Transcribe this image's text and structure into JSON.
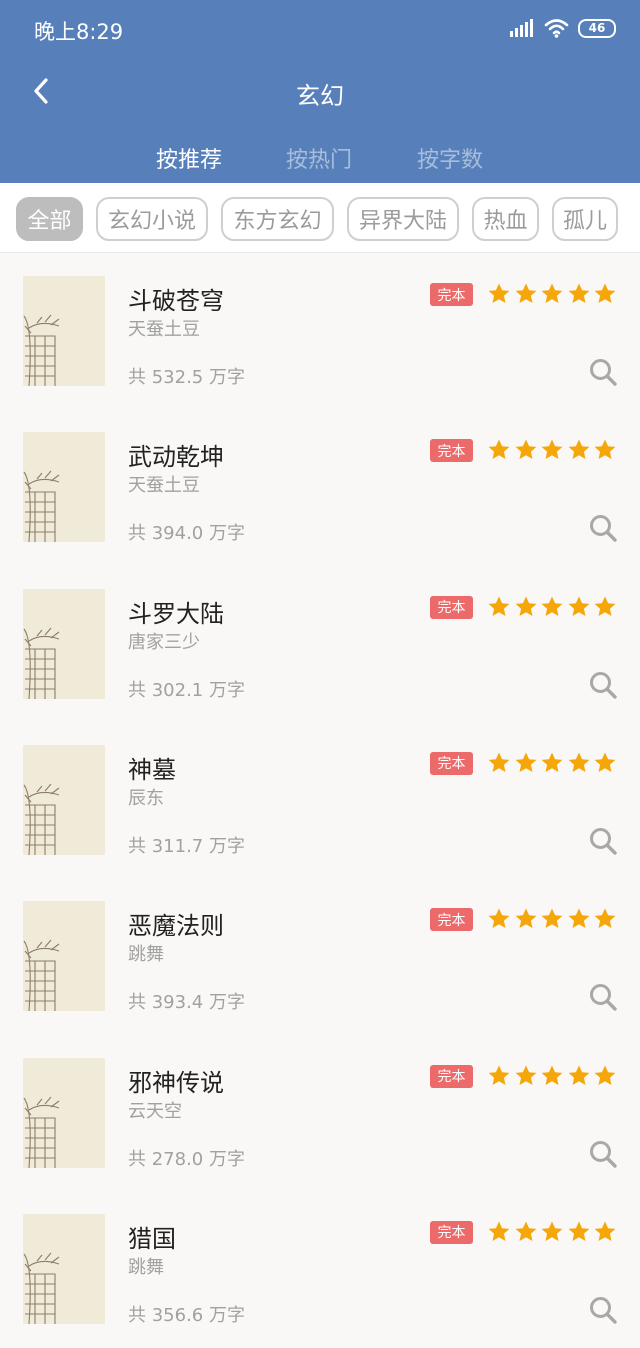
{
  "status_bar": {
    "time": "晚上8:29",
    "battery": "46"
  },
  "header": {
    "title": "玄幻"
  },
  "tabs": [
    {
      "label": "按推荐"
    },
    {
      "label": "按热门"
    },
    {
      "label": "按字数"
    }
  ],
  "filters": [
    "全部",
    "玄幻小说",
    "东方玄幻",
    "异界大陆",
    "热血",
    "孤儿"
  ],
  "books": [
    {
      "title": "斗破苍穹",
      "author": "天蚕土豆",
      "count": "共 532.5 万字",
      "status": "完本",
      "rating": 5
    },
    {
      "title": "武动乾坤",
      "author": "天蚕土豆",
      "count": "共 394.0 万字",
      "status": "完本",
      "rating": 5
    },
    {
      "title": "斗罗大陆",
      "author": "唐家三少",
      "count": "共 302.1 万字",
      "status": "完本",
      "rating": 5
    },
    {
      "title": "神墓",
      "author": "辰东",
      "count": "共 311.7 万字",
      "status": "完本",
      "rating": 5
    },
    {
      "title": "恶魔法则",
      "author": "跳舞",
      "count": "共 393.4 万字",
      "status": "完本",
      "rating": 5
    },
    {
      "title": "邪神传说",
      "author": "云天空",
      "count": "共 278.0 万字",
      "status": "完本",
      "rating": 5
    },
    {
      "title": "猎国",
      "author": "跳舞",
      "count": "共 356.6 万字",
      "status": "完本",
      "rating": 5
    }
  ],
  "colors": {
    "header": "#5780bb",
    "badge": "#ec6a6a",
    "star": "#f5a70a"
  },
  "icons": {
    "back": "chevron-left-icon",
    "search": "search-icon",
    "star": "star-icon",
    "signal": "signal-icon",
    "wifi": "wifi-icon",
    "battery": "battery-icon"
  }
}
